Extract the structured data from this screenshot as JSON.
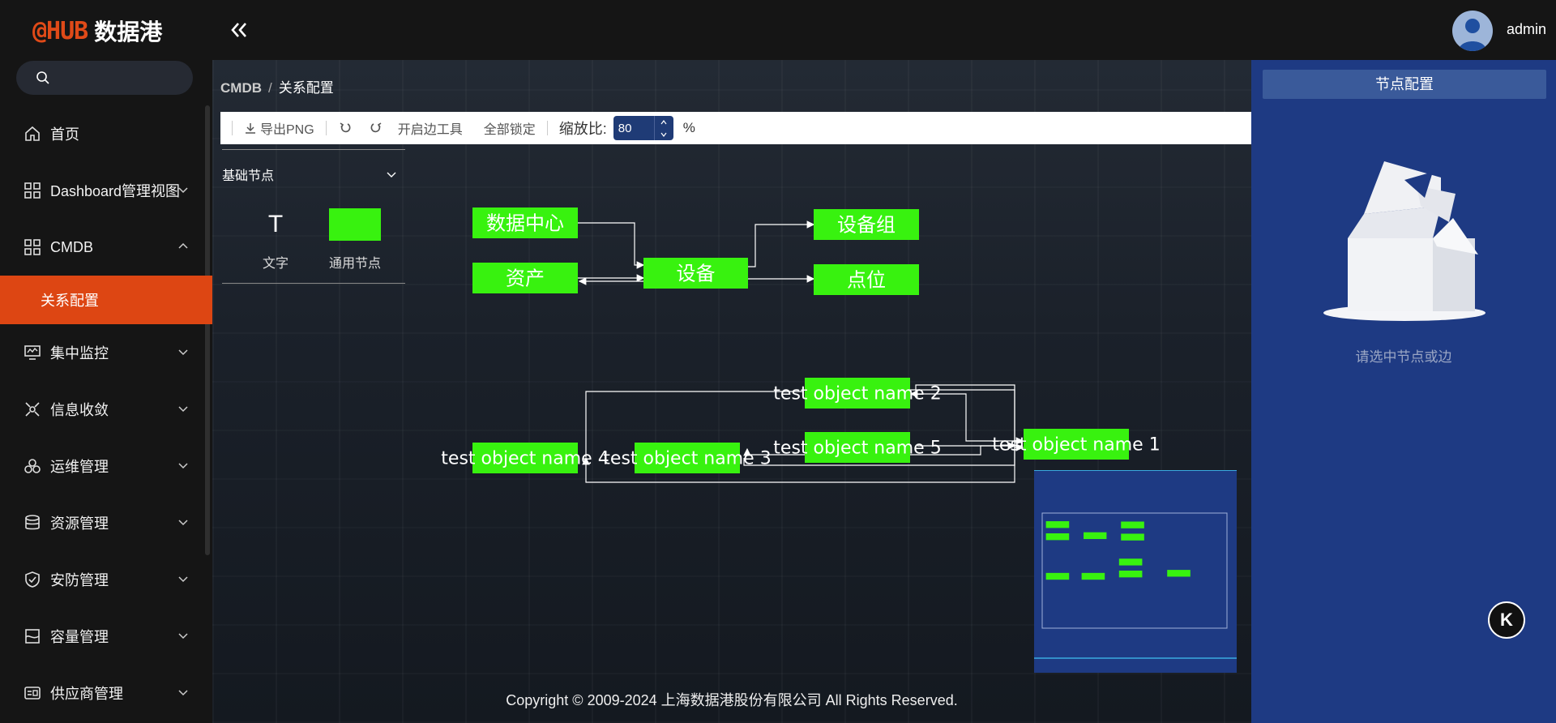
{
  "app": {
    "logo_mark": "@HUB",
    "logo_text": "数据港"
  },
  "search": {
    "placeholder": ""
  },
  "sidebar": {
    "items": [
      {
        "label": "首页"
      },
      {
        "label": "Dashboard管理视图"
      },
      {
        "label": "CMDB"
      },
      {
        "label": "关系配置"
      },
      {
        "label": "集中监控"
      },
      {
        "label": "信息收敛"
      },
      {
        "label": "运维管理"
      },
      {
        "label": "资源管理"
      },
      {
        "label": "安防管理"
      },
      {
        "label": "容量管理"
      },
      {
        "label": "供应商管理"
      }
    ]
  },
  "header": {
    "username": "admin"
  },
  "breadcrumb": {
    "root": "CMDB",
    "sep": "/",
    "current": "关系配置"
  },
  "toolbar": {
    "export": "导出PNG",
    "edge_tool": "开启边工具",
    "lock_all": "全部锁定",
    "zoom_label": "缩放比:",
    "zoom_value": "80",
    "zoom_unit": "%"
  },
  "palette": {
    "title": "基础节点",
    "items": [
      {
        "icon": "T",
        "label": "文字"
      },
      {
        "label": "通用节点"
      }
    ]
  },
  "graph": {
    "node_color": "#38f20f",
    "nodes": [
      {
        "label": "数据中心"
      },
      {
        "label": "资产"
      },
      {
        "label": "设备"
      },
      {
        "label": "设备组"
      },
      {
        "label": "点位"
      },
      {
        "label": "test object name 2"
      },
      {
        "label": "test object name 5"
      },
      {
        "label": "test object name 1"
      },
      {
        "label": "test object name 4"
      },
      {
        "label": "test object name 3"
      }
    ]
  },
  "footer": {
    "copyright": "Copyright © 2009-2024 上海数据港股份有限公司 All Rights Reserved."
  },
  "right_panel": {
    "title": "节点配置",
    "empty_text": "请选中节点或边"
  },
  "fab": {
    "label": "K"
  }
}
